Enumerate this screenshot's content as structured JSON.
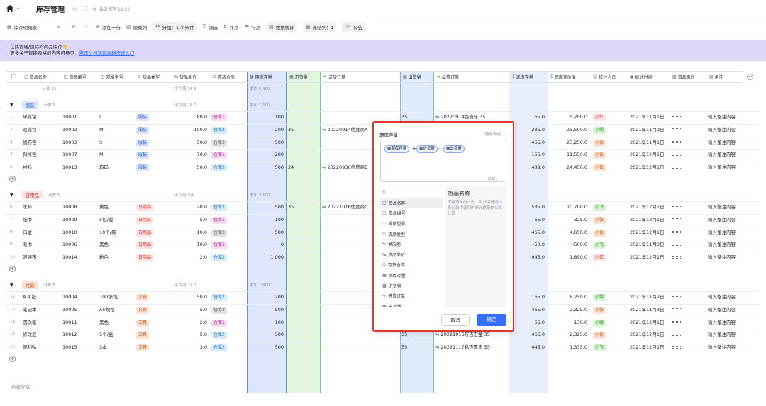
{
  "topbar": {
    "title": "库存管理",
    "saved": "最近保存 11:22"
  },
  "toolbar": {
    "view": "库存明细表",
    "add_row": "添加一行",
    "hidden_cols": "隐藏列",
    "group": "分组：1 个条件",
    "filter": "筛选",
    "sort": "排序",
    "row_height": "行高",
    "stats": "数据统计",
    "frozen": "冻结列：1",
    "notice": "公告"
  },
  "banner": {
    "line1": "在此管理/追踪的商品库存👋",
    "line2_prefix": "更多关于智能表格的内容可参见：",
    "line2_link": "腾讯文档智能表格快速入门"
  },
  "columns": [
    "货品名称",
    "货品编号",
    "规格型号",
    "货品类型",
    "货品单价",
    "存放仓库",
    "期库存量",
    "进货量",
    "进货订单",
    "出货量",
    "出货订单",
    "现库存量",
    "现库存价值",
    "统计人员",
    "统计时间",
    "货品图片",
    "备注"
  ],
  "summary": {
    "count": "计数 15",
    "avg_price": "平均值 30.8",
    "sum_stock": "求和 5,400"
  },
  "groups": [
    {
      "name": "服装",
      "count": "计数 5",
      "avg": "平均值 70.0",
      "sum": "求和 1,500",
      "rows": [
        {
          "n": "1",
          "name": "单肩包",
          "code": "10001",
          "spec": "L",
          "type": "服装",
          "price": "80.0",
          "wh": "仓库1",
          "stock": "100",
          "in": "",
          "in_order": "",
          "out": "35",
          "out_order": "20220914西班牙 35",
          "cur": "65.0",
          "val": "5,200.0",
          "person": "小红",
          "date": "2021年11月1日",
          "note": "输入备注内容"
        },
        {
          "n": "2",
          "name": "双肩包",
          "code": "10002",
          "spec": "M",
          "type": "服装",
          "price": "100.0",
          "wh": "仓库2",
          "stock": "200",
          "in": "35",
          "in_order": "20220914优度商A",
          "out": "",
          "out_order": "",
          "cur": "235.0",
          "val": "23,500.0",
          "person": "小绿",
          "date": "2021年11月2日",
          "note": "输入备注内容"
        },
        {
          "n": "3",
          "name": "帆布包",
          "code": "10003",
          "spec": "S",
          "type": "服装",
          "price": "50.0",
          "wh": "仓库3",
          "stock": "500",
          "in": "",
          "in_order": "",
          "out": "",
          "out_order": "",
          "cur": "465.0",
          "val": "23,250.0",
          "person": "小张",
          "date": "2021年11月1日",
          "note": "输入备注内容"
        },
        {
          "n": "4",
          "name": "斜挎包",
          "code": "10007",
          "spec": "M",
          "type": "服装",
          "price": "70.0",
          "wh": "仓库1",
          "stock": "200",
          "in": "",
          "in_order": "",
          "out": "",
          "out_order": "",
          "cur": "165.0",
          "val": "11,550.0",
          "person": "小张",
          "date": "2021年12月1日",
          "note": "输入备注内容"
        },
        {
          "n": "5",
          "name": "衬衫",
          "code": "10013",
          "spec": "均码",
          "type": "服装",
          "price": "50.0",
          "wh": "仓库2",
          "stock": "500",
          "in": "24",
          "in_order": "20220930优度商B",
          "out": "",
          "out_order": "",
          "cur": "489.0",
          "val": "24,450.0",
          "person": "小张",
          "date": "2021年12月1日",
          "note": "输入备注内容"
        }
      ]
    },
    {
      "name": "日用品",
      "count": "计数 5",
      "avg": "平均值 9.4",
      "sum": "求和 2,100",
      "rows": [
        {
          "n": "6",
          "name": "水杯",
          "code": "10008",
          "spec": "黄色",
          "type": "日用品",
          "price": "20.0",
          "wh": "仓库2",
          "stock": "500",
          "in": "35",
          "in_order": "20221016优度商C",
          "out": "",
          "out_order": "",
          "cur": "535.0",
          "val": "10,700.0",
          "person": "小飞",
          "date": "2021年12月1日",
          "note": "输入备注内容"
        },
        {
          "n": "7",
          "name": "纸巾",
          "code": "10009",
          "spec": "5包/提",
          "type": "日用品",
          "price": "5.0",
          "wh": "仓库1",
          "stock": "100",
          "in": "",
          "in_order": "",
          "out": "",
          "out_order": "",
          "cur": "65.0",
          "val": "325.0",
          "person": "小张",
          "date": "2021年12月1日",
          "note": "输入备注内容"
        },
        {
          "n": "8",
          "name": "口罩",
          "code": "10010",
          "spec": "10个/袋",
          "type": "日用品",
          "price": "10.0",
          "wh": "仓库3",
          "stock": "500",
          "in": "",
          "in_order": "",
          "out": "",
          "out_order": "",
          "cur": "465.0",
          "val": "4,650.0",
          "person": "小张",
          "date": "2021年12月1日",
          "note": "输入备注内容"
        },
        {
          "n": "9",
          "name": "毛巾",
          "code": "10006",
          "spec": "黑色",
          "type": "日用品",
          "price": "10.0",
          "wh": "仓库1",
          "stock": "0",
          "in": "",
          "in_order": "",
          "out": "",
          "out_order": "",
          "cur": "-50.0",
          "val": "-500.0",
          "person": "小飞",
          "date": "2021年11月3日",
          "note": "输入备注内容"
        },
        {
          "n": "10",
          "name": "眼镜布",
          "code": "10014",
          "spec": "粉色",
          "type": "日用品",
          "price": "2.0",
          "wh": "仓库2",
          "stock": "1,000",
          "in": "",
          "in_order": "",
          "out": "",
          "out_order": "",
          "cur": "945.0",
          "val": "1,890.0",
          "person": "小红",
          "date": "2021年12月1日",
          "note": "输入备注内容"
        }
      ]
    },
    {
      "name": "文具",
      "count": "计数 5",
      "avg": "平均值 13.0",
      "sum": "求和 1,800",
      "rows": [
        {
          "n": "11",
          "name": "A 4 纸",
          "code": "10004",
          "spec": "100张/包",
          "type": "文具",
          "price": "50.0",
          "wh": "仓库2",
          "stock": "200",
          "in": "",
          "in_order": "",
          "out": "",
          "out_order": "",
          "cur": "165.0",
          "val": "8,250.0",
          "person": "小绿",
          "date": "2021年11月2日",
          "note": "输入备注内容"
        },
        {
          "n": "12",
          "name": "笔记本",
          "code": "10005",
          "spec": "A5规格",
          "type": "文具",
          "price": "5.0",
          "wh": "仓库3",
          "stock": "500",
          "in": "",
          "in_order": "",
          "out": "",
          "out_order": "",
          "cur": "465.0",
          "val": "2,325.0",
          "person": "小张",
          "date": "2021年11月3日",
          "note": "输入备注内容"
        },
        {
          "n": "13",
          "name": "圆珠笔",
          "code": "10011",
          "spec": "黑色",
          "type": "文具",
          "price": "2.0",
          "wh": "仓库1",
          "stock": "100",
          "in": "",
          "in_order": "",
          "out": "",
          "out_order": "",
          "cur": "65.0",
          "val": "130.0",
          "person": "小绿",
          "date": "2021年12月1日",
          "note": "输入备注内容"
        },
        {
          "n": "14",
          "name": "修改液",
          "code": "10012",
          "spec": "5个/盒",
          "type": "文具",
          "price": "5.0",
          "wh": "仓库2",
          "stock": "500",
          "in": "",
          "in_order": "",
          "out": "35",
          "out_order": "20221016万吉五金 35",
          "cur": "465.0",
          "val": "2,325.0",
          "person": "小张",
          "date": "2021年12月1日",
          "note": "输入备注内容"
        },
        {
          "n": "15",
          "name": "便利贴",
          "code": "10015",
          "spec": "3本",
          "type": "文具",
          "price": "3.0",
          "wh": "仓库2",
          "stock": "500",
          "in": "",
          "in_order": "",
          "out": "55",
          "out_order": "20221117彩杰零售 55",
          "cur": "445.0",
          "val": "1,335.0",
          "person": "小飞",
          "date": "2021年12月1日",
          "note": "输入备注内容"
        }
      ]
    }
  ],
  "new_group": "新建分组",
  "dialog": {
    "title": "期库存量",
    "help": "使用说明",
    "tokens": [
      "期库存量",
      "进货量",
      "出货量"
    ],
    "ops": [
      "+",
      "-"
    ],
    "fn_hint": "公式⌄",
    "section": "列",
    "fields": [
      "货品名称",
      "货品编号",
      "规格型号",
      "货品类型",
      "供应商",
      "货品单价",
      "存放仓库",
      "期库存量",
      "进货量",
      "进货订单",
      "出货量"
    ],
    "desc_title": "货品名称",
    "desc_text": "库存清单的一列，可以引用同一条记录中该列的单元格来作公式计算",
    "cancel": "取消",
    "ok": "确定"
  },
  "colors": {
    "accent": "#3370ff",
    "stock_col": "#dde6fb",
    "in_col": "#e3f4e1",
    "out_col": "#e1ecfa",
    "cur_col": "#e8eefc",
    "dialog_border": "#e0362b",
    "banner": "#ddd6f9"
  }
}
